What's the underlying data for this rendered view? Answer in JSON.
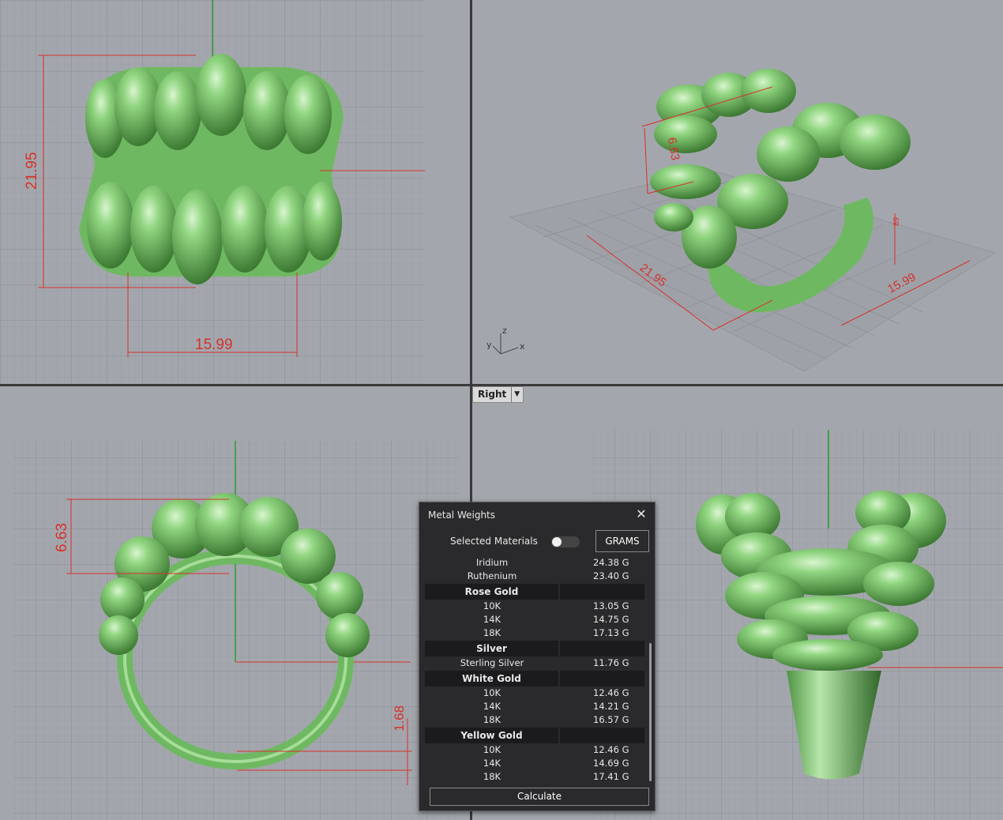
{
  "viewports": {
    "top_left": {
      "dims": [
        "21.95",
        "15.99"
      ]
    },
    "top_right": {
      "dims": [
        "6.63",
        "21.95",
        "15.99",
        "89"
      ],
      "axes": [
        "z",
        "y",
        "x"
      ]
    },
    "bottom_left": {
      "name": "Right",
      "dims": [
        "6.63",
        "1.68"
      ]
    }
  },
  "panel": {
    "title": "Metal Weights",
    "selected_materials_label": "Selected Materials",
    "selected_materials_on": false,
    "units_button": "GRAMS",
    "calculate_button": "Calculate",
    "rows": [
      {
        "name": "Iridium",
        "weight": "24.38 G"
      },
      {
        "name": "Ruthenium",
        "weight": "23.40 G"
      }
    ],
    "groups": [
      {
        "name": "Rose Gold",
        "rows": [
          {
            "name": "10K",
            "weight": "13.05 G"
          },
          {
            "name": "14K",
            "weight": "14.75 G"
          },
          {
            "name": "18K",
            "weight": "17.13 G"
          }
        ]
      },
      {
        "name": "Silver",
        "rows": [
          {
            "name": "Sterling Silver",
            "weight": "11.76 G"
          }
        ]
      },
      {
        "name": "White Gold",
        "rows": [
          {
            "name": "10K",
            "weight": "12.46 G"
          },
          {
            "name": "14K",
            "weight": "14.21 G"
          },
          {
            "name": "18K",
            "weight": "16.57 G"
          }
        ]
      },
      {
        "name": "Yellow Gold",
        "rows": [
          {
            "name": "10K",
            "weight": "12.46 G"
          },
          {
            "name": "14K",
            "weight": "14.69 G"
          },
          {
            "name": "18K",
            "weight": "17.41 G"
          }
        ]
      }
    ]
  },
  "colors": {
    "viewport_bg": "#a3a7ad",
    "model": "#8ed27f",
    "dimension": "#d7302a",
    "panel_bg": "#2a2a2c"
  }
}
